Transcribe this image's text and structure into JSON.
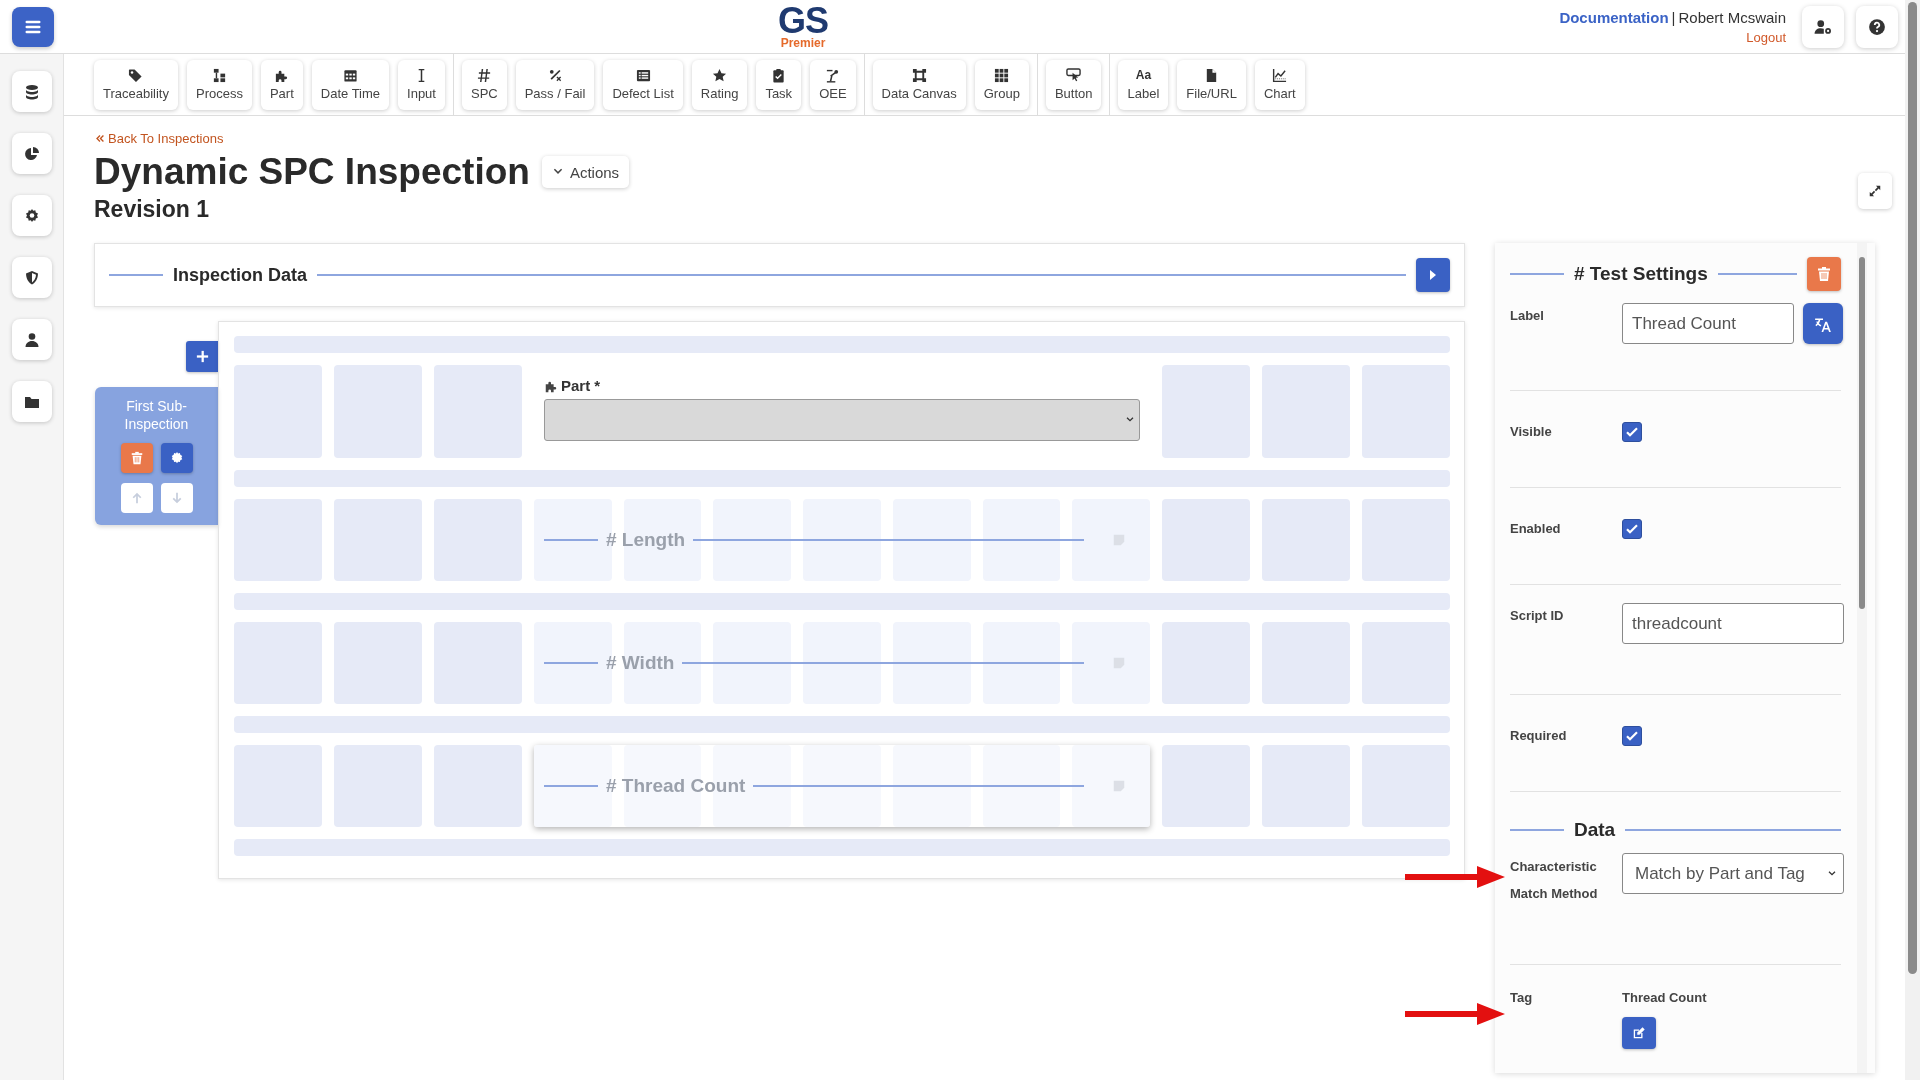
{
  "header": {
    "logo": {
      "main": "GS",
      "sub": "Premier"
    },
    "documentation_link": "Documentation",
    "separator": "|",
    "user": "Robert Mcswain",
    "logout": "Logout"
  },
  "toolbar": {
    "groups": [
      [
        {
          "label": "Traceability"
        },
        {
          "label": "Process"
        },
        {
          "label": "Part"
        },
        {
          "label": "Date Time"
        },
        {
          "label": "Input"
        }
      ],
      [
        {
          "label": "SPC"
        },
        {
          "label": "Pass / Fail"
        },
        {
          "label": "Defect List"
        },
        {
          "label": "Rating"
        },
        {
          "label": "Task"
        },
        {
          "label": "OEE"
        }
      ],
      [
        {
          "label": "Data Canvas"
        },
        {
          "label": "Group"
        }
      ],
      [
        {
          "label": "Button"
        }
      ],
      [
        {
          "label": "Label",
          "glyph": "Aa"
        },
        {
          "label": "File/URL"
        },
        {
          "label": "Chart"
        }
      ]
    ]
  },
  "page": {
    "back_link": "Back To Inspections",
    "title": "Dynamic SPC Inspection",
    "actions_button": "Actions",
    "revision": "Revision 1"
  },
  "section": {
    "title": "Inspection Data"
  },
  "sub_inspections": [
    {
      "label": "First Sub-Inspection",
      "selected": true
    }
  ],
  "canvas": {
    "rows": [
      {
        "kind": "select",
        "label": "Part *"
      },
      {
        "kind": "field",
        "label": "# Length",
        "selected": false
      },
      {
        "kind": "field",
        "label": "# Width",
        "selected": false
      },
      {
        "kind": "field",
        "label": "# Thread Count",
        "selected": true
      }
    ]
  },
  "settings": {
    "title": "# Test Settings",
    "rows": [
      {
        "kind": "text_translate",
        "label": "Label",
        "value": "Thread Count"
      },
      {
        "kind": "checkbox",
        "label": "Visible",
        "checked": true
      },
      {
        "kind": "checkbox",
        "label": "Enabled",
        "checked": true
      },
      {
        "kind": "text",
        "label": "Script ID",
        "value": "threadcount"
      },
      {
        "kind": "checkbox",
        "label": "Required",
        "checked": true
      }
    ],
    "data_title": "Data",
    "data_rows": [
      {
        "kind": "select",
        "label": "Characteristic Match Method",
        "value": "Match by Part and Tag"
      },
      {
        "kind": "tag",
        "label": "Tag",
        "value": "Thread Count"
      }
    ]
  }
}
